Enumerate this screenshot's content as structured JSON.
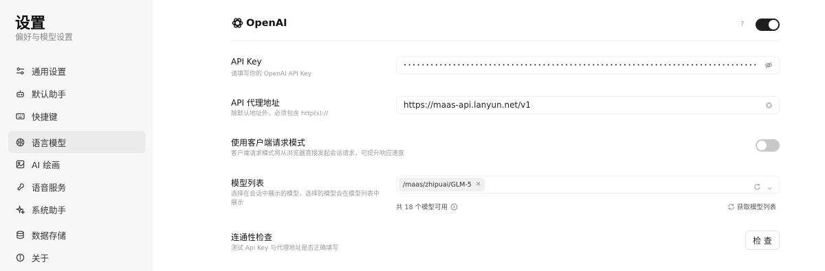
{
  "sidebar": {
    "title": "设置",
    "subtitle": "偏好与模型设置",
    "items": [
      {
        "label": "通用设置",
        "icon": "sliders-icon"
      },
      {
        "label": "默认助手",
        "icon": "bot-icon"
      },
      {
        "label": "快捷键",
        "icon": "keyboard-icon"
      },
      {
        "label": "语言模型",
        "icon": "brain-icon",
        "active": true
      },
      {
        "label": "AI 绘画",
        "icon": "image-icon"
      },
      {
        "label": "语音服务",
        "icon": "mic-icon"
      },
      {
        "label": "系统助手",
        "icon": "sparkles-icon"
      },
      {
        "label": "数据存储",
        "icon": "database-icon"
      },
      {
        "label": "关于",
        "icon": "info-icon"
      }
    ]
  },
  "provider": {
    "name": "OpenAI",
    "help": "?",
    "enabled": true
  },
  "settings": {
    "api_key": {
      "label": "API Key",
      "desc": "请填写你的 OpenAI API Key",
      "masked_value": "••••••••••••••••••••••••••••••••••••••••••••••••••••••••••••••••••••••••••••••••"
    },
    "proxy": {
      "label": "API 代理地址",
      "desc": "除默认地址外，必须包含 http(s)://",
      "value": "https://maas-api.lanyun.net/v1"
    },
    "client_mode": {
      "label": "使用客户端请求模式",
      "desc": "客户端请求模式将从浏览器直接发起会话请求，可提升响应速度",
      "enabled": false
    },
    "models": {
      "label": "模型列表",
      "desc": "选择在会话中展示的模型，选择的模型会在模型列表中展示",
      "selected": [
        "/maas/zhipuai/GLM-5"
      ],
      "count_text": "共 18 个模型可用",
      "fetch_label": "获取模型列表"
    },
    "check": {
      "label": "连通性检查",
      "desc": "测试 Api Key 与代理地址是否正确填写",
      "button": "检 查"
    }
  }
}
